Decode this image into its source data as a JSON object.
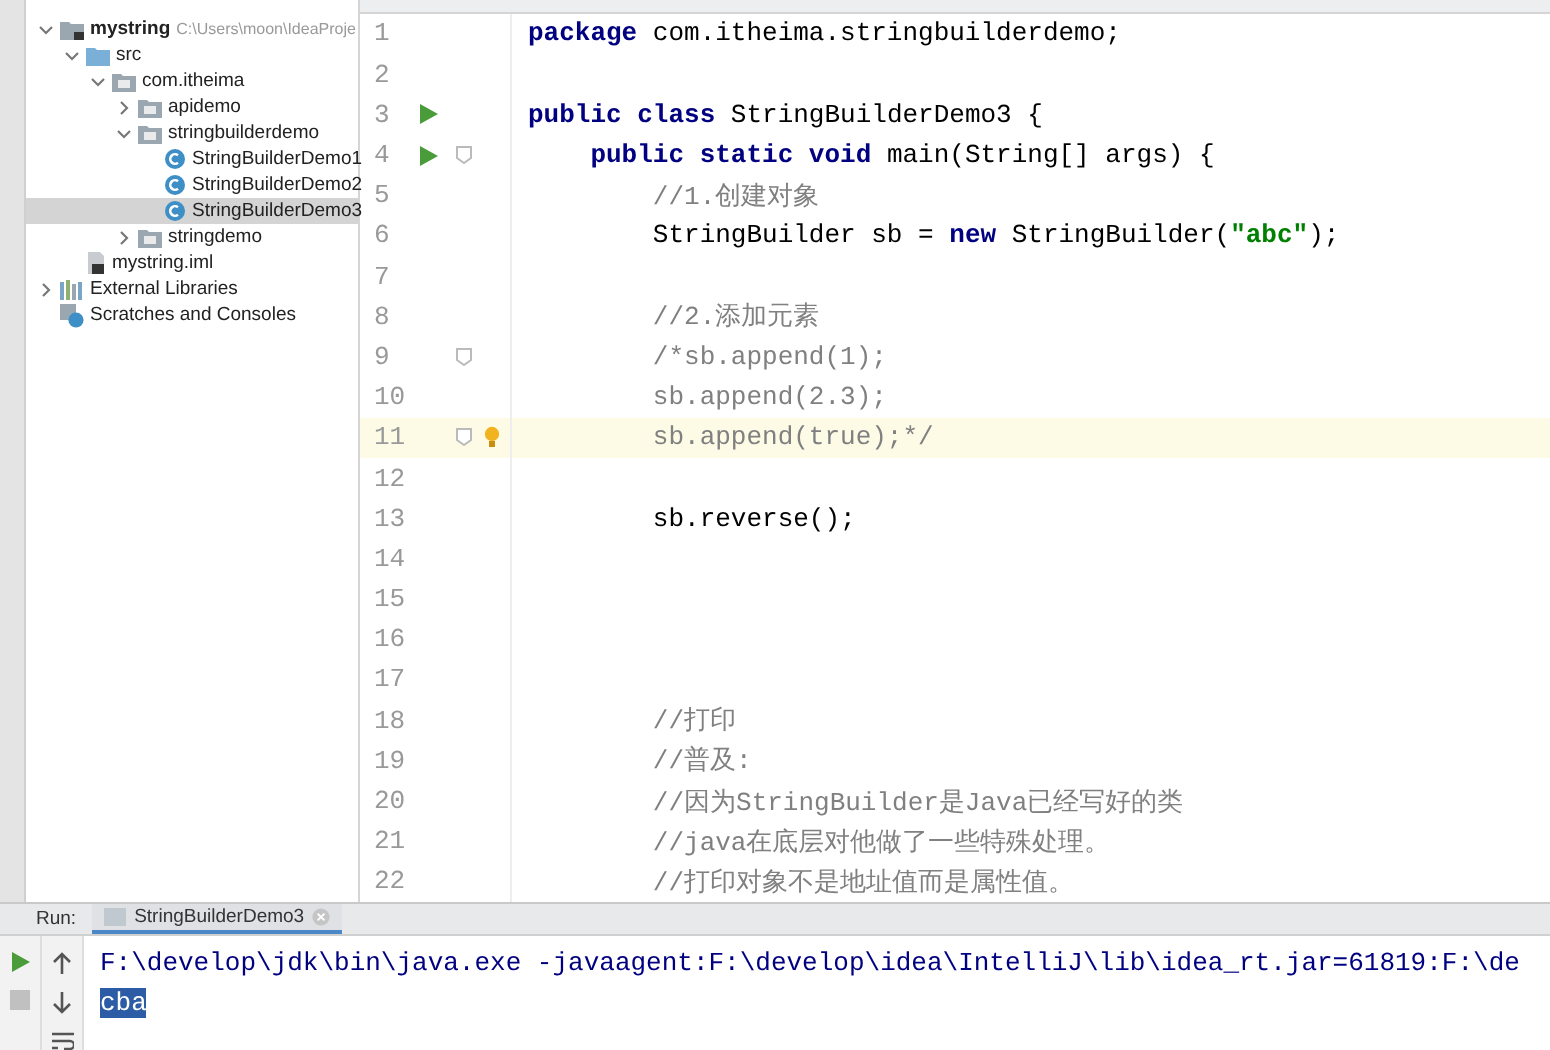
{
  "project_tree": [
    {
      "label": "mystring",
      "kind": "module",
      "hint": "C:\\Users\\moon\\IdeaProje",
      "expanded": true,
      "selected": false,
      "children": [
        {
          "label": "src",
          "kind": "source",
          "expanded": true,
          "selected": false,
          "children": [
            {
              "label": "com.itheima",
              "kind": "package",
              "expanded": true,
              "selected": false,
              "children": [
                {
                  "label": "apidemo",
                  "kind": "package",
                  "expanded": false,
                  "selected": false
                },
                {
                  "label": "stringbuilderdemo",
                  "kind": "package",
                  "expanded": true,
                  "selected": false,
                  "children": [
                    {
                      "label": "StringBuilderDemo1",
                      "kind": "class",
                      "selected": false
                    },
                    {
                      "label": "StringBuilderDemo2",
                      "kind": "class",
                      "selected": false
                    },
                    {
                      "label": "StringBuilderDemo3",
                      "kind": "class",
                      "selected": true
                    }
                  ]
                },
                {
                  "label": "stringdemo",
                  "kind": "package",
                  "expanded": false,
                  "selected": false
                }
              ]
            }
          ]
        },
        {
          "label": "mystring.iml",
          "kind": "file",
          "selected": false
        }
      ]
    },
    {
      "label": "External Libraries",
      "kind": "libraries",
      "expanded": false,
      "selected": false
    },
    {
      "label": "Scratches and Consoles",
      "kind": "scratches",
      "selected": false
    }
  ],
  "editor": {
    "lines": [
      {
        "number": "1",
        "current": false,
        "run": false,
        "fold": false,
        "bulb": false,
        "tokens": [
          {
            "kind": "keyword",
            "text": "package"
          },
          {
            "kind": "plain",
            "text": " com.itheima.stringbuilderdemo;"
          }
        ]
      },
      {
        "number": "2",
        "current": false,
        "run": false,
        "fold": false,
        "bulb": false
      },
      {
        "number": "3",
        "current": false,
        "run": true,
        "fold": false,
        "bulb": false,
        "tokens": [
          {
            "kind": "keyword",
            "text": "public class"
          },
          {
            "kind": "plain",
            "text": " StringBuilderDemo3 {"
          }
        ]
      },
      {
        "number": "4",
        "current": false,
        "run": true,
        "fold": true,
        "bulb": false,
        "tokens": [
          {
            "kind": "keyword",
            "text": "    public static void"
          },
          {
            "kind": "plain",
            "text": " main(String[] args) {"
          }
        ]
      },
      {
        "number": "5",
        "current": false,
        "run": false,
        "fold": false,
        "bulb": false,
        "tokens": [
          {
            "kind": "comment",
            "text": "        //1.创建对象"
          }
        ]
      },
      {
        "number": "6",
        "current": false,
        "run": false,
        "fold": false,
        "bulb": false,
        "tokens": [
          {
            "kind": "plain",
            "text": "        StringBuilder sb = "
          },
          {
            "kind": "keyword",
            "text": "new"
          },
          {
            "kind": "plain",
            "text": " StringBuilder("
          },
          {
            "kind": "string",
            "text": "\"abc\""
          },
          {
            "kind": "plain",
            "text": ");"
          }
        ]
      },
      {
        "number": "7",
        "current": false,
        "run": false,
        "fold": false,
        "bulb": false
      },
      {
        "number": "8",
        "current": false,
        "run": false,
        "fold": false,
        "bulb": false,
        "tokens": [
          {
            "kind": "comment",
            "text": "        //2.添加元素"
          }
        ]
      },
      {
        "number": "9",
        "current": false,
        "run": false,
        "fold": true,
        "bulb": false,
        "tokens": [
          {
            "kind": "comment",
            "text": "        /*sb.append(1);"
          }
        ]
      },
      {
        "number": "10",
        "current": false,
        "run": false,
        "fold": false,
        "bulb": false,
        "tokens": [
          {
            "kind": "comment",
            "text": "        sb.append(2.3);"
          }
        ]
      },
      {
        "number": "11",
        "current": true,
        "run": false,
        "fold": true,
        "bulb": true,
        "tokens": [
          {
            "kind": "comment",
            "text": "        sb.append(true);*/"
          }
        ]
      },
      {
        "number": "12",
        "current": false,
        "run": false,
        "fold": false,
        "bulb": false
      },
      {
        "number": "13",
        "current": false,
        "run": false,
        "fold": false,
        "bulb": false,
        "tokens": [
          {
            "kind": "plain",
            "text": "        sb.reverse();"
          }
        ]
      },
      {
        "number": "14",
        "current": false,
        "run": false,
        "fold": false,
        "bulb": false
      },
      {
        "number": "15",
        "current": false,
        "run": false,
        "fold": false,
        "bulb": false
      },
      {
        "number": "16",
        "current": false,
        "run": false,
        "fold": false,
        "bulb": false
      },
      {
        "number": "17",
        "current": false,
        "run": false,
        "fold": false,
        "bulb": false
      },
      {
        "number": "18",
        "current": false,
        "run": false,
        "fold": false,
        "bulb": false,
        "tokens": [
          {
            "kind": "comment",
            "text": "        //打印"
          }
        ]
      },
      {
        "number": "19",
        "current": false,
        "run": false,
        "fold": false,
        "bulb": false,
        "tokens": [
          {
            "kind": "comment",
            "text": "        //普及:"
          }
        ]
      },
      {
        "number": "20",
        "current": false,
        "run": false,
        "fold": false,
        "bulb": false,
        "tokens": [
          {
            "kind": "comment",
            "text": "        //因为StringBuilder是Java已经写好的类"
          }
        ]
      },
      {
        "number": "21",
        "current": false,
        "run": false,
        "fold": false,
        "bulb": false,
        "tokens": [
          {
            "kind": "comment",
            "text": "        //java在底层对他做了一些特殊处理。"
          }
        ]
      },
      {
        "number": "22",
        "current": false,
        "run": false,
        "fold": false,
        "bulb": false,
        "tokens": [
          {
            "kind": "comment",
            "text": "        //打印对象不是地址值而是属性值。"
          }
        ]
      }
    ]
  },
  "run_panel": {
    "label": "Run:",
    "tabs": [
      {
        "label": "StringBuilderDemo3",
        "selected": true
      }
    ],
    "output": [
      {
        "text": "F:\\develop\\jdk\\bin\\java.exe -javaagent:F:\\develop\\idea\\IntelliJ\\lib\\idea_rt.jar=61819:F:\\de",
        "selected": false
      },
      {
        "text": "cba",
        "selected": true
      }
    ]
  }
}
